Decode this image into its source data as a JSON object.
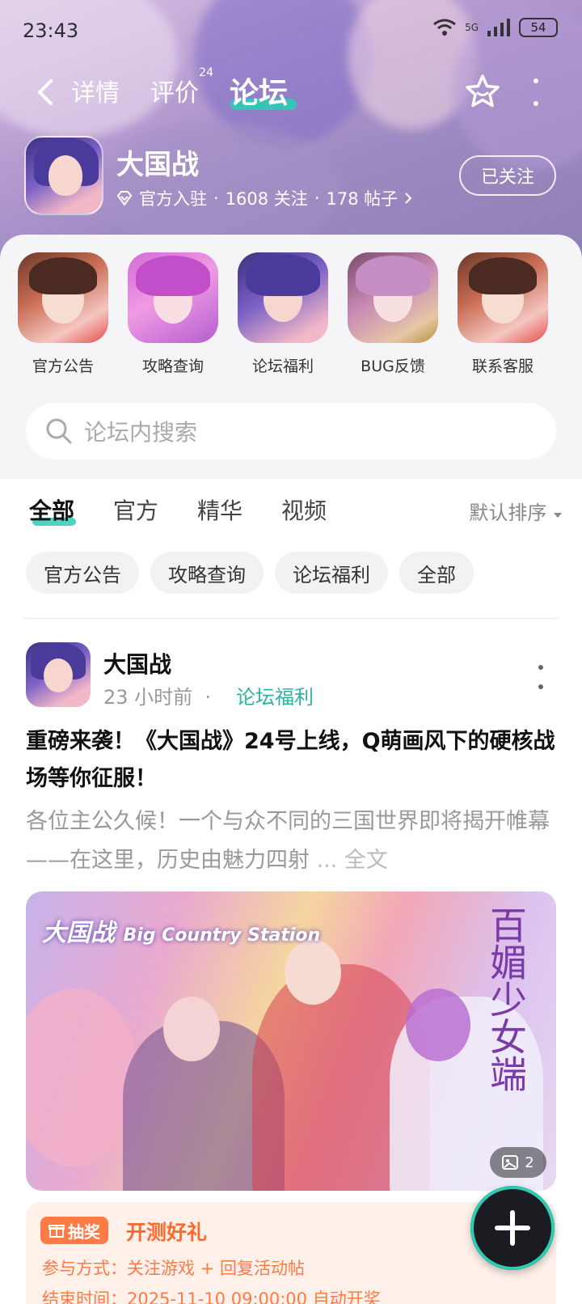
{
  "status_bar": {
    "time": "23:43",
    "network": "5G",
    "battery": "54"
  },
  "nav": {
    "tabs": [
      {
        "label": "详情"
      },
      {
        "label": "评价",
        "badge": "24"
      },
      {
        "label": "论坛"
      }
    ]
  },
  "game": {
    "title": "大国战",
    "verified": "官方入驻",
    "followers": "1608 关注",
    "posts": "178 帖子",
    "follow_label": "已关注"
  },
  "quick_links": [
    {
      "label": "官方公告"
    },
    {
      "label": "攻略查询"
    },
    {
      "label": "论坛福利"
    },
    {
      "label": "BUG反馈"
    },
    {
      "label": "联系客服"
    }
  ],
  "search": {
    "placeholder": "论坛内搜索"
  },
  "filter_tabs": [
    {
      "label": "全部"
    },
    {
      "label": "官方"
    },
    {
      "label": "精华"
    },
    {
      "label": "视频"
    }
  ],
  "sort": {
    "label": "默认排序"
  },
  "chips": [
    {
      "label": "官方公告"
    },
    {
      "label": "攻略查询"
    },
    {
      "label": "论坛福利"
    },
    {
      "label": "全部"
    }
  ],
  "post": {
    "author": "大国战",
    "time": "23 小时前",
    "category": "论坛福利",
    "title": "重磅来袭！《大国战》24号上线，Q萌画风下的硬核战场等你征服！",
    "body": "各位主公久候！一个与众不同的三国世界即将揭开帷幕——在这里，历史由魅力四射",
    "read_more": "... 全文",
    "image_count": "2",
    "image_logo": "大国战",
    "image_logo_en": "Big Country Station",
    "image_callig": "百媚少女端"
  },
  "gift": {
    "tag": "抽奖",
    "title": "开测好礼",
    "line1": "参与方式：关注游戏 + 回复活动帖",
    "line2": "结束时间：2025-11-10 09:00:00 自动开奖"
  },
  "colors": {
    "accent": "#2ecbb3",
    "gift_orange": "#ff7a45"
  }
}
